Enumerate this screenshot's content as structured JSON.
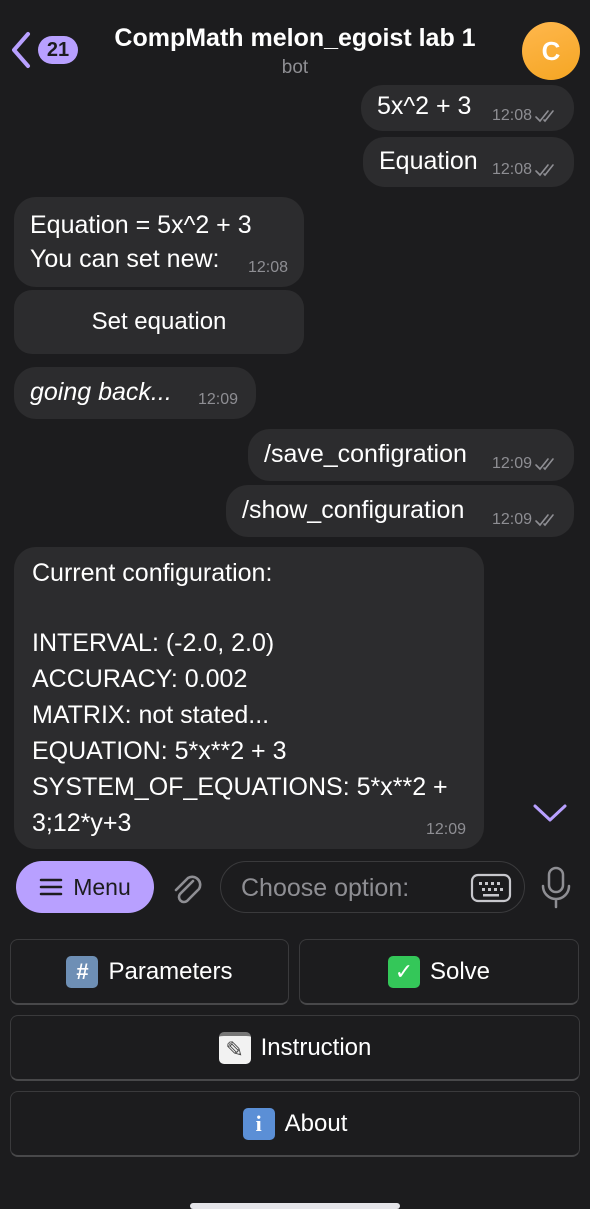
{
  "header": {
    "back_count": "21",
    "title": "CompMath melon_egoist lab 1",
    "subtitle": "bot",
    "avatar_letter": "C"
  },
  "messages": [
    {
      "from": "me",
      "text": "5x^2 + 3",
      "time": "12:08"
    },
    {
      "from": "me",
      "text": "Equation",
      "time": "12:08"
    },
    {
      "from": "bot",
      "line1": "Equation = 5x^2  +  3",
      "line2": "You can set new:",
      "time": "12:08",
      "button": "Set equation"
    },
    {
      "from": "bot",
      "text": "going back...",
      "time": "12:09"
    },
    {
      "from": "me",
      "text": "/save_configration",
      "time": "12:09"
    },
    {
      "from": "me",
      "text": "/show_configuration",
      "time": "12:09"
    }
  ],
  "config_message": {
    "lines": [
      "Current configuration:",
      "",
      "INTERVAL: (-2.0, 2.0)",
      "ACCURACY: 0.002",
      "MATRIX: not stated...",
      "EQUATION: 5*x**2 + 3",
      "SYSTEM_OF_EQUATIONS: 5*x**2 +",
      "3;12*y+3"
    ],
    "time": "12:09"
  },
  "input_bar": {
    "menu_label": "Menu",
    "placeholder": "Choose option:"
  },
  "reply_keyboard": {
    "parameters": {
      "emoji": "#",
      "label": "Parameters"
    },
    "solve": {
      "emoji": "✓",
      "label": "Solve"
    },
    "instruction": {
      "emoji": "✎",
      "label": "Instruction"
    },
    "about": {
      "emoji": "i",
      "label": "About"
    }
  },
  "colors": {
    "background": "#1c1c1e",
    "bubble": "#2c2c2e",
    "accent": "#b8a0ff",
    "avatar": "#f5a623",
    "solve_green": "#34c759",
    "info_blue": "#5b8fd6"
  }
}
